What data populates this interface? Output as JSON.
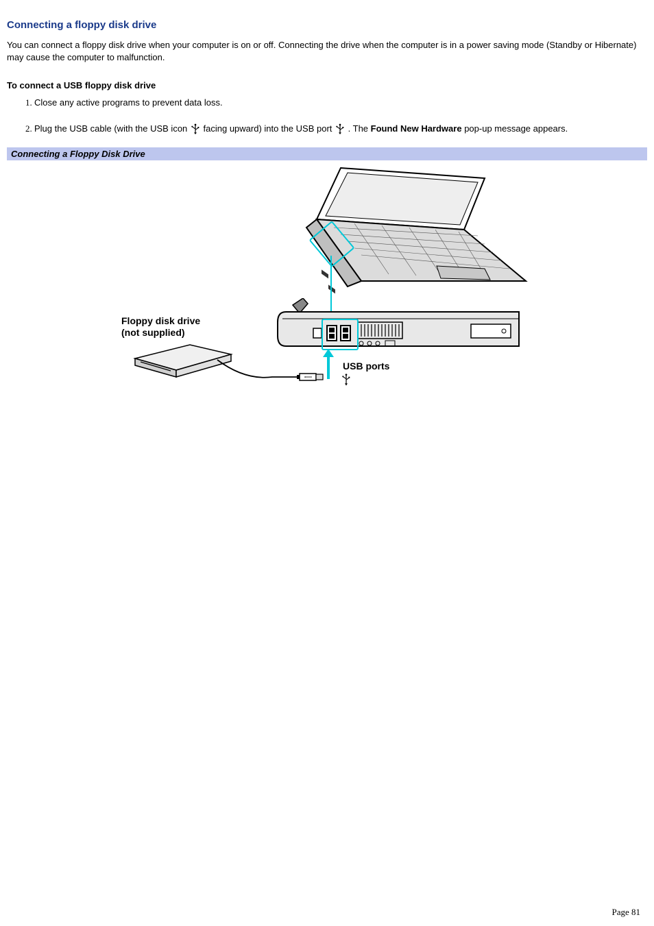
{
  "section_title": "Connecting a floppy disk drive",
  "intro_paragraph": "You can connect a floppy disk drive when your computer is on or off. Connecting the drive when the computer is in a power saving mode (Standby or Hibernate) may cause the computer to malfunction.",
  "procedure_title": "To connect a USB floppy disk drive",
  "steps": {
    "s1": "Close any active programs to prevent data loss.",
    "s2_a": "Plug the USB cable (with the USB icon ",
    "s2_b": " facing upward) into the USB port ",
    "s2_c": ". The ",
    "s2_bold": "Found New Hardware",
    "s2_d": " pop-up message appears."
  },
  "figure_caption": "Connecting a Floppy Disk Drive",
  "figure_labels": {
    "fdd_line1": "Floppy disk drive",
    "fdd_line2": "(not supplied)",
    "usb_ports": "USB ports"
  },
  "page_label": "Page 81"
}
